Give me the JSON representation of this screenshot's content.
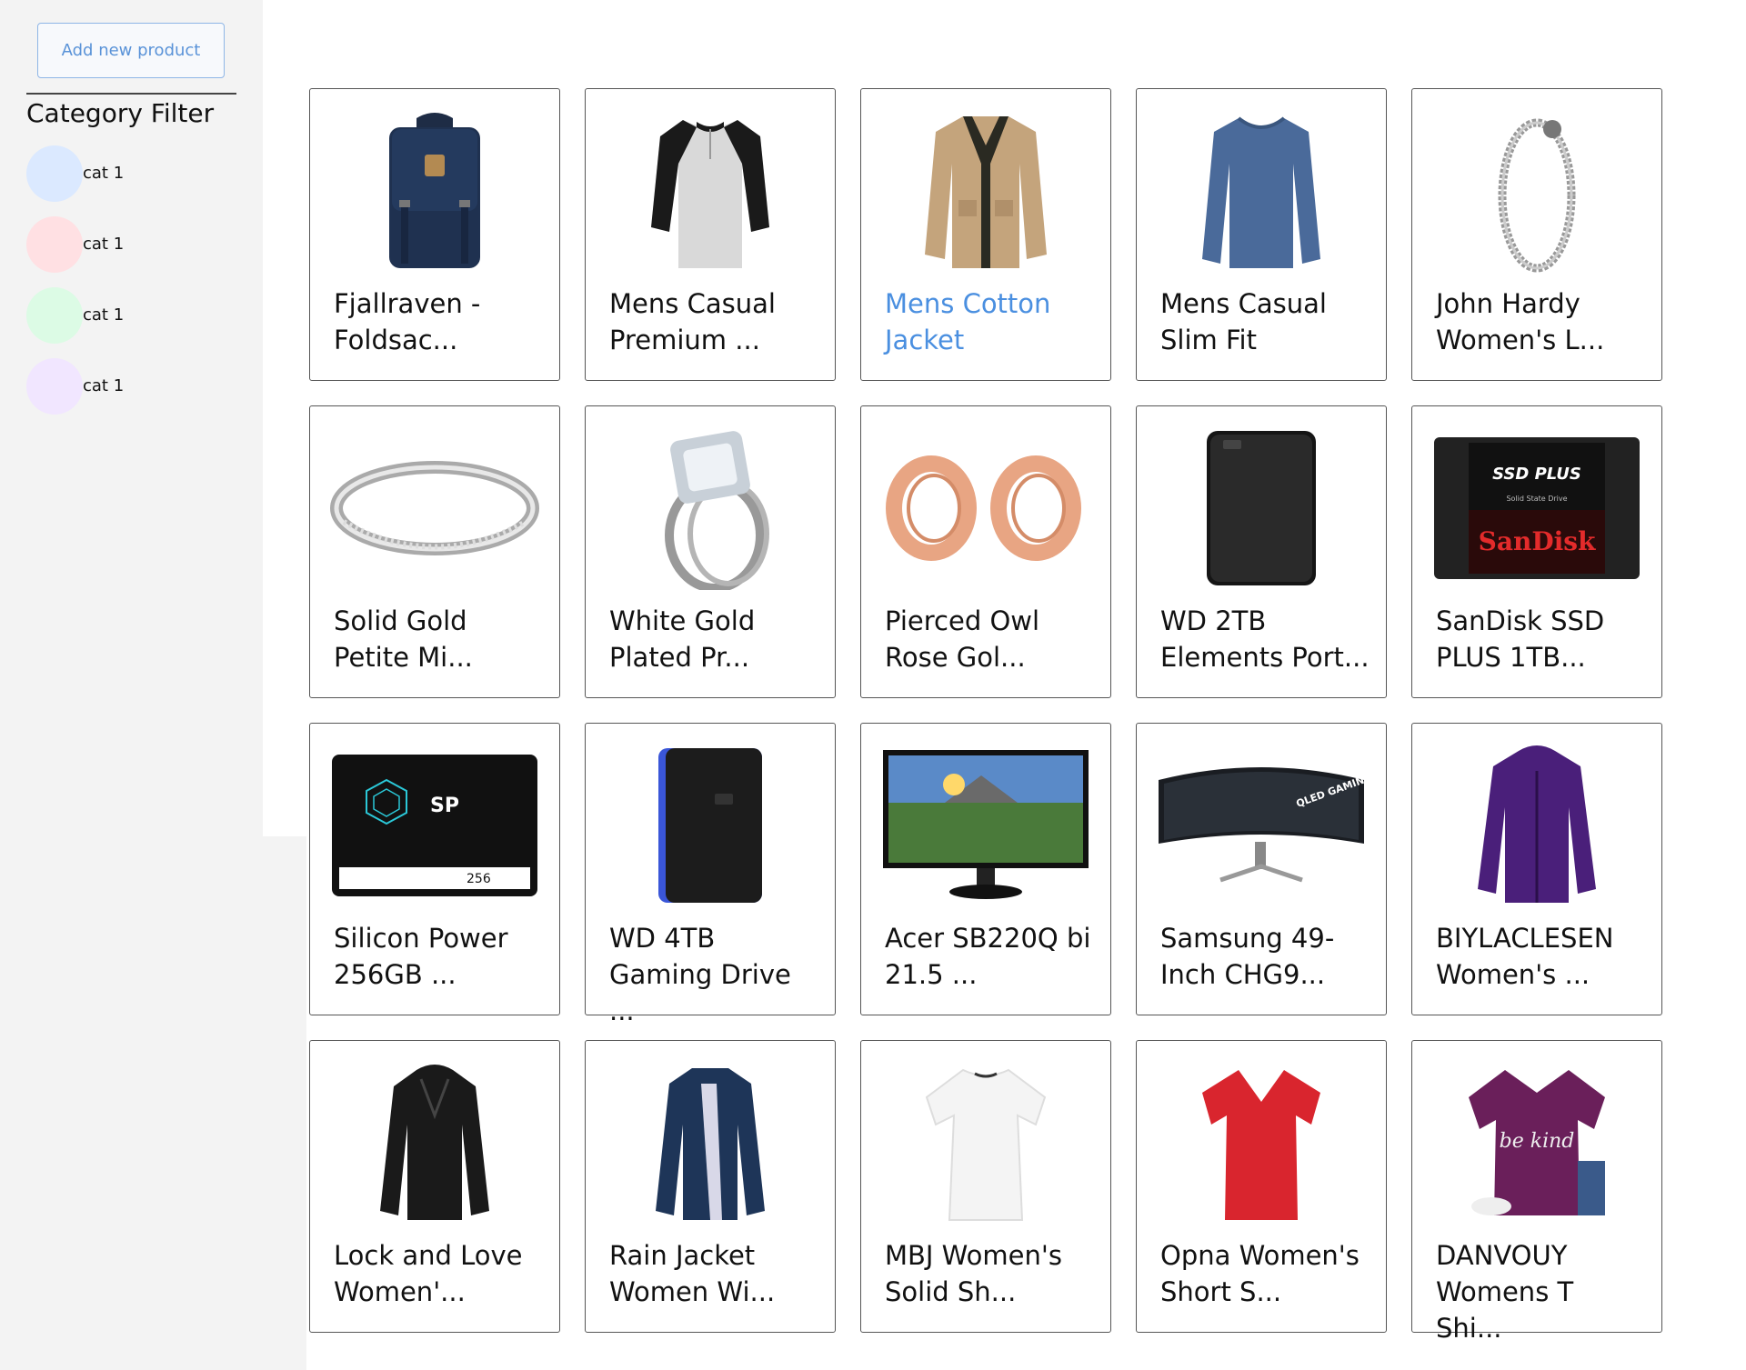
{
  "sidebar": {
    "add_button_label": "Add new product",
    "filter_title": "Category Filter",
    "categories": [
      {
        "label": "cat 1",
        "color": "#dbe9ff"
      },
      {
        "label": "cat 1",
        "color": "#ffe0e3"
      },
      {
        "label": "cat 1",
        "color": "#dcfbe5"
      },
      {
        "label": "cat 1",
        "color": "#f1e6ff"
      }
    ]
  },
  "products": [
    {
      "title": "Fjallraven - Foldsac...",
      "icon": "backpack-icon"
    },
    {
      "title": "Mens Casual Premium ...",
      "icon": "raglan-shirt-icon"
    },
    {
      "title": "Mens Cotton Jacket",
      "icon": "jacket-icon",
      "highlighted": true
    },
    {
      "title": "Mens Casual Slim Fit",
      "icon": "long-sleeve-shirt-icon"
    },
    {
      "title": "John Hardy Women's L...",
      "icon": "bracelet-icon"
    },
    {
      "title": "Solid Gold Petite Mi...",
      "icon": "ring-icon"
    },
    {
      "title": "White Gold Plated Pr...",
      "icon": "diamond-ring-icon"
    },
    {
      "title": "Pierced Owl Rose Gol...",
      "icon": "ear-tunnel-icon"
    },
    {
      "title": "WD 2TB Elements Port...",
      "icon": "hard-drive-icon"
    },
    {
      "title": "SanDisk SSD PLUS 1TB...",
      "icon": "ssd-icon",
      "text": {
        "top": "SSD PLUS",
        "sub": "Solid State Drive",
        "brand": "SanDisk"
      }
    },
    {
      "title": "Silicon Power 256GB ...",
      "icon": "ssd-sp-icon",
      "text": {
        "brand": "SP",
        "capacity": "256"
      }
    },
    {
      "title": "WD 4TB Gaming Drive ...",
      "icon": "gaming-drive-icon"
    },
    {
      "title": "Acer SB220Q bi 21.5 ...",
      "icon": "monitor-icon"
    },
    {
      "title": "Samsung 49-Inch CHG9...",
      "icon": "curved-monitor-icon",
      "text": {
        "label": "QLED GAMING MONITOR"
      }
    },
    {
      "title": "BIYLACLESEN Women's ...",
      "icon": "purple-jacket-icon"
    },
    {
      "title": "Lock and Love Women'...",
      "icon": "leather-jacket-icon"
    },
    {
      "title": "Rain Jacket Women Wi...",
      "icon": "rain-jacket-icon"
    },
    {
      "title": "MBJ Women's Solid Sh...",
      "icon": "white-tshirt-icon"
    },
    {
      "title": "Opna Women's Short S...",
      "icon": "red-tshirt-icon"
    },
    {
      "title": "DANVOUY Womens T Shi...",
      "icon": "be-kind-tshirt-icon",
      "text": {
        "print": "be kind"
      }
    }
  ]
}
